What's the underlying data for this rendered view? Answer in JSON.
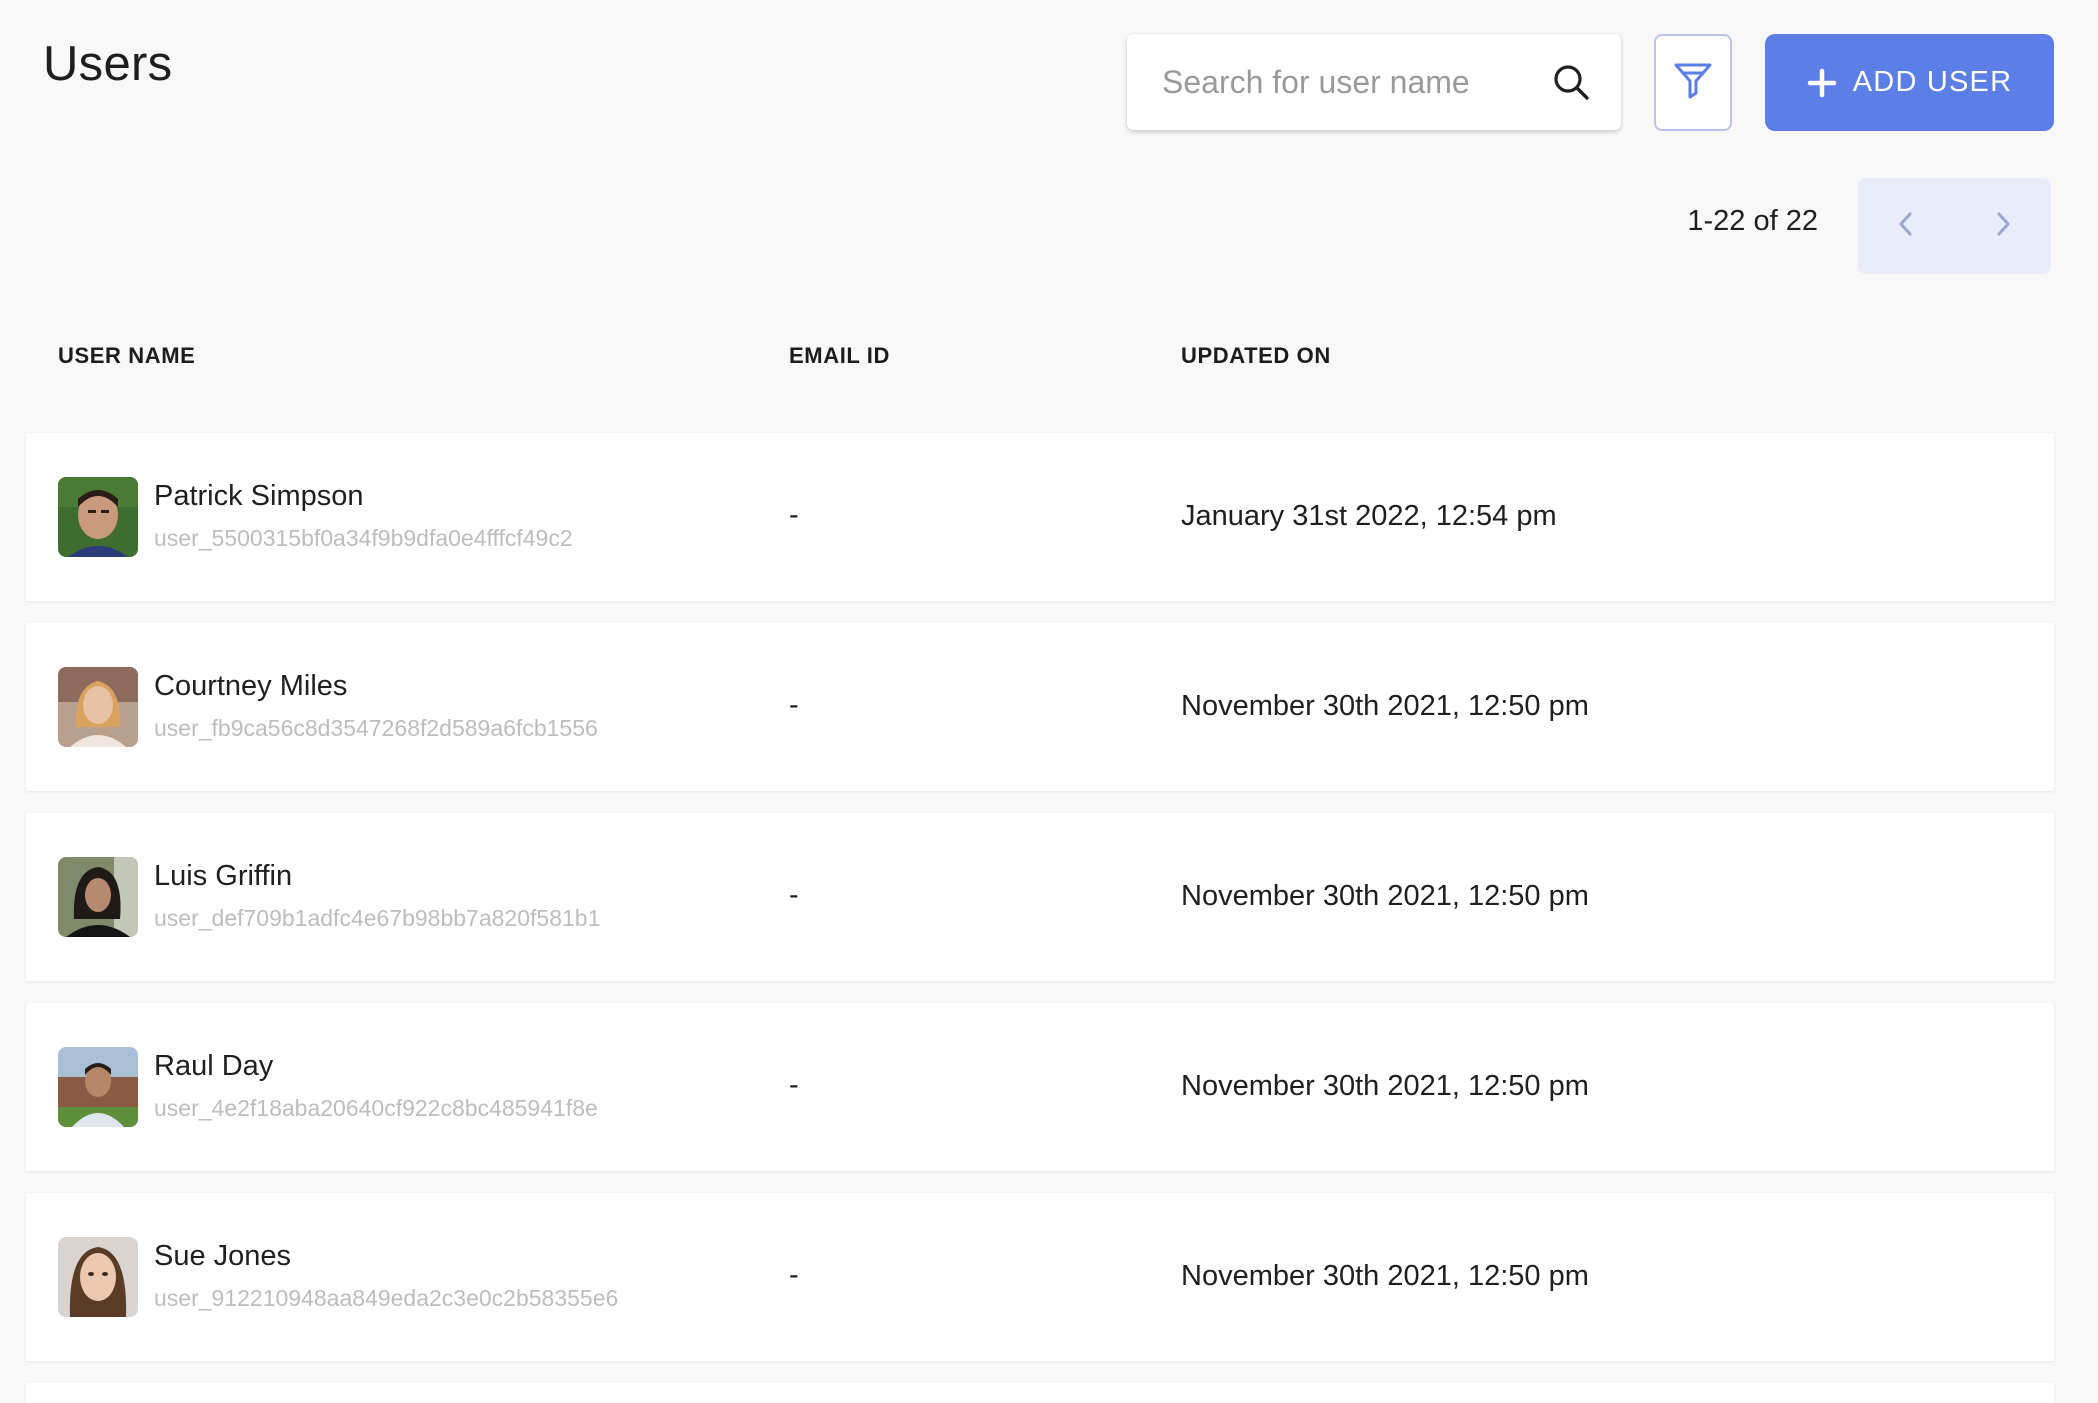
{
  "page": {
    "title": "Users"
  },
  "search": {
    "placeholder": "Search for user name",
    "value": "",
    "icon": "search-icon"
  },
  "toolbar": {
    "filter_icon": "filter-icon",
    "add_user_label": "ADD USER",
    "add_user_icon": "plus-icon"
  },
  "pagination": {
    "range_text": "1-22 of 22",
    "prev_icon": "chevron-left-icon",
    "next_icon": "chevron-right-icon"
  },
  "table": {
    "columns": [
      "USER NAME",
      "EMAIL ID",
      "UPDATED ON"
    ],
    "rows": [
      {
        "name": "Patrick Simpson",
        "user_id": "user_5500315bf0a34f9b9dfa0e4fffcf49c2",
        "email": "-",
        "updated_on": "January 31st 2022, 12:54 pm",
        "avatar_icon": "avatar-icon"
      },
      {
        "name": "Courtney Miles",
        "user_id": "user_fb9ca56c8d3547268f2d589a6fcb1556",
        "email": "-",
        "updated_on": "November 30th 2021, 12:50 pm",
        "avatar_icon": "avatar-icon"
      },
      {
        "name": "Luis Griffin",
        "user_id": "user_def709b1adfc4e67b98bb7a820f581b1",
        "email": "-",
        "updated_on": "November 30th 2021, 12:50 pm",
        "avatar_icon": "avatar-icon"
      },
      {
        "name": "Raul Day",
        "user_id": "user_4e2f18aba20640cf922c8bc485941f8e",
        "email": "-",
        "updated_on": "November 30th 2021, 12:50 pm",
        "avatar_icon": "avatar-icon"
      },
      {
        "name": "Sue Jones",
        "user_id": "user_912210948aa849eda2c3e0c2b58355e6",
        "email": "-",
        "updated_on": "November 30th 2021, 12:50 pm",
        "avatar_icon": "avatar-icon"
      }
    ]
  },
  "colors": {
    "accent": "#5b7fe6",
    "accent_light": "#e8ecfb",
    "background": "#f8f8f8",
    "muted_text": "#bdbdbd"
  }
}
